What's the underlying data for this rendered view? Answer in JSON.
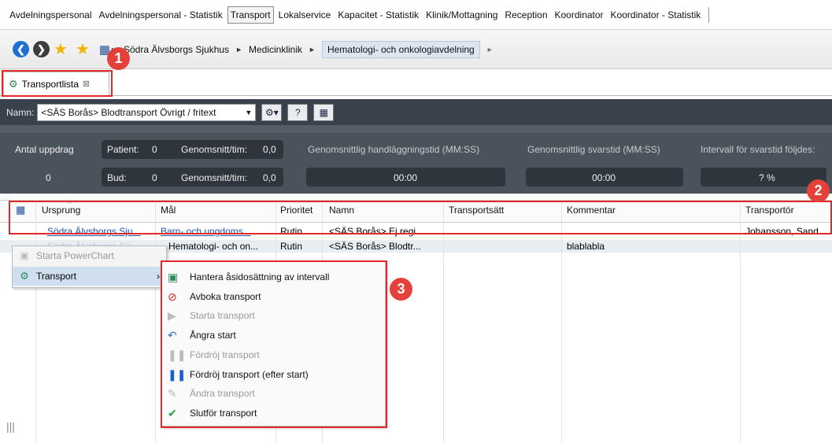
{
  "menu": {
    "tabs": [
      "Avdelningspersonal",
      "Avdelningspersonal - Statistik",
      "Transport",
      "Lokalservice",
      "Kapacitet - Statistik",
      "Klinik/Mottagning",
      "Reception",
      "Koordinator",
      "Koordinator - Statistik"
    ],
    "active": "Transport"
  },
  "nav": {
    "crumbs": [
      "Södra Älvsborgs Sjukhus",
      "Medicinklinik",
      "Hematologi- och onkologiavdelning"
    ]
  },
  "tab": {
    "label": "Transportlista",
    "close": "⊠"
  },
  "toolbar": {
    "name_label": "Namn:",
    "name_value": "<SÄS Borås> Blodtransport Övrigt / fritext"
  },
  "stats": {
    "antal_label": "Antal uppdrag",
    "antal_value": "0",
    "patient_label": "Patient:",
    "patient_value": "0",
    "bud_label": "Bud:",
    "bud_value": "0",
    "snitt_label": "Genomsnitt/tim:",
    "snitt_patient": "0,0",
    "snitt_bud": "0,0",
    "handl_label": "Genomsnittlig handläggningstid (MM:SS)",
    "handl_value": "00:00",
    "svar_label": "Genomsnittlig svarstid (MM:SS)",
    "svar_value": "00:00",
    "intervall_label": "Intervall för svarstid följdes:",
    "intervall_value": "? %"
  },
  "grid": {
    "columns": [
      "Ursprung",
      "Mål",
      "Prioritet",
      "Namn",
      "Transportsätt",
      "Kommentar",
      "Transportör"
    ],
    "rows": [
      {
        "ursprung": "Södra Älvsborgs Sju...",
        "mal": "Barn- och ungdoms...",
        "prio": "Rutin",
        "namn": "<SÄS Borås> Ej regi...",
        "sätt": "",
        "kommentar": "",
        "transportor": "Johansson, Sand"
      },
      {
        "ursprung": "Södra Älvsborgs Sju...",
        "mal": "Hematologi- och on...",
        "prio": "Rutin",
        "namn": "<SÄS Borås> Blodtr...",
        "sätt": "",
        "kommentar": "blablabla",
        "transportor": ""
      }
    ]
  },
  "context_menu": {
    "items": [
      "Starta PowerChart",
      "Transport"
    ]
  },
  "submenu": {
    "items": [
      {
        "label": "Hantera åsidosättning av intervall",
        "enabled": true
      },
      {
        "label": "Avboka transport",
        "enabled": true
      },
      {
        "label": "Starta transport",
        "enabled": false
      },
      {
        "label": "Ångra start",
        "enabled": true
      },
      {
        "label": "Fördröj transport",
        "enabled": false
      },
      {
        "label": "Fördröj transport (efter start)",
        "enabled": true
      },
      {
        "label": "Ändra transport",
        "enabled": false
      },
      {
        "label": "Slutför transport",
        "enabled": true
      }
    ]
  },
  "badges": [
    "1",
    "2",
    "3"
  ],
  "colors": {
    "annotation": "#e02a2a",
    "toolbar": "#39414c",
    "link": "#1a55b8"
  }
}
